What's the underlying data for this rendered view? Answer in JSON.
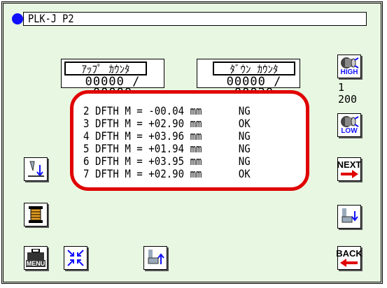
{
  "header": {
    "title": "PLK-J P2",
    "indicator_color": "#1010ff"
  },
  "counters": {
    "up": {
      "label": "ｱｯﾌﾟ ｶｳﾝﾀ",
      "value": "00000 / 00000"
    },
    "down": {
      "label": "ﾀﾞｳﾝ ｶｳﾝﾀ",
      "value": "00000 / 00020"
    }
  },
  "results": [
    {
      "text": "2 DFTH M = -00.04 mm",
      "status": "NG"
    },
    {
      "text": "3 DFTH M = +02.90 mm",
      "status": "OK"
    },
    {
      "text": "4 DFTH M = +03.96 mm",
      "status": "NG"
    },
    {
      "text": "5 DFTH M = +01.94 mm",
      "status": "NG"
    },
    {
      "text": "6 DFTH M = +03.95 mm",
      "status": "NG"
    },
    {
      "text": "7 DFTH M = +02.90 mm",
      "status": "OK"
    }
  ],
  "speed": {
    "high_label": "HIGH",
    "low_label": "LOW",
    "step": "1",
    "value": "200"
  },
  "buttons": {
    "next_label": "NEXT",
    "back_label": "BACK",
    "menu_label": "MENU"
  },
  "colors": {
    "background": "#e8f7e2",
    "accent_red": "#e00000",
    "accent_blue": "#1010ff"
  }
}
